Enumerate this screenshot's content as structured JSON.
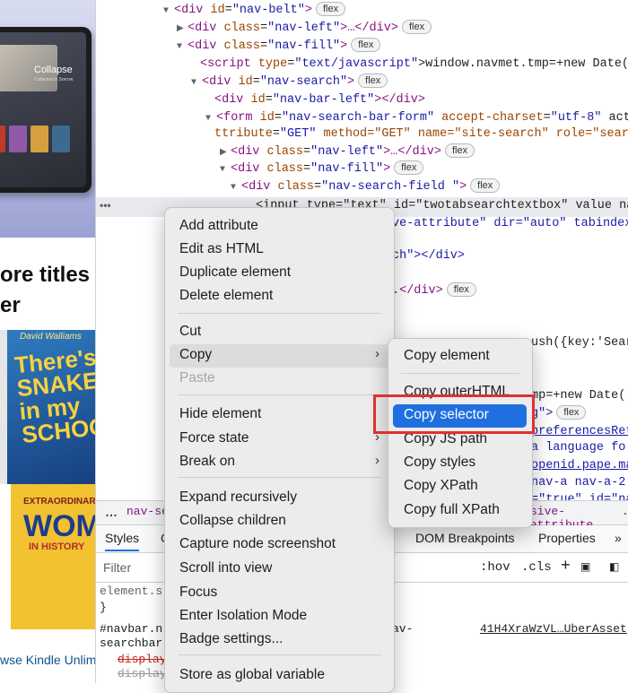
{
  "page": {
    "tablet_title": "Collapse",
    "tablet_subtitle": "Collected in Sorrow",
    "promo_line1": "ore titles",
    "promo_line2": "er",
    "book1_author": "David Walliams",
    "book1_title": "There's a SNAKE in my SCHOOL!",
    "book2_line1": "EXTRAORDINARY",
    "book2_line2": "WOMEN",
    "book2_line3": "IN HISTORY",
    "kindle_link": "wse Kindle Unlim"
  },
  "elements": {
    "lines": [
      {
        "indent": 75,
        "tri": "▼",
        "tag": "div",
        "attrs": [
          [
            "id",
            "nav-belt"
          ]
        ],
        "tail": ">",
        "badge": "flex"
      },
      {
        "indent": 90,
        "tri": "▶",
        "tag": "div",
        "attrs": [
          [
            "class",
            "nav-left"
          ]
        ],
        "tail": ">…</div>",
        "badge": "flex"
      },
      {
        "indent": 90,
        "tri": "▼",
        "tag": "div",
        "attrs": [
          [
            "class",
            "nav-fill"
          ]
        ],
        "tail": ">",
        "badge": "flex"
      },
      {
        "indent": 116,
        "tri": "",
        "tag": "script",
        "attrs": [
          [
            "type",
            "text/javascript"
          ]
        ],
        "tail": ">window.navmet.tmp=+new Date()",
        "badge": ""
      },
      {
        "indent": 106,
        "tri": "▼",
        "tag": "div",
        "attrs": [
          [
            "id",
            "nav-search"
          ]
        ],
        "tail": ">",
        "badge": "flex"
      },
      {
        "indent": 132,
        "tri": "",
        "tag": "div",
        "attrs": [
          [
            "id",
            "nav-bar-left"
          ]
        ],
        "tail": "></div>",
        "badge": ""
      },
      {
        "indent": 122,
        "tri": "▼",
        "tag": "form",
        "attrs": [
          [
            "id",
            "nav-search-bar-form"
          ],
          [
            "accept-charset",
            "utf-8"
          ]
        ],
        "tail": " acti",
        "badge": ""
      },
      {
        "indent": 132,
        "tri": "",
        "tag": "",
        "attrs": [
          [
            "ttribute",
            "GET"
          ]
        ],
        "tail": "",
        "badge": ""
      },
      {
        "indent": 138,
        "tri": "▶",
        "tag": "div",
        "attrs": [
          [
            "class",
            "nav-left"
          ]
        ],
        "tail": ">…</div>",
        "badge": "flex"
      },
      {
        "indent": 138,
        "tri": "▼",
        "tag": "div",
        "attrs": [
          [
            "class",
            "nav-fill"
          ]
        ],
        "tail": ">",
        "badge": "flex"
      },
      {
        "indent": 150,
        "tri": "▼",
        "tag": "div",
        "attrs": [
          [
            "class",
            "nav-search-field "
          ]
        ],
        "tail": ">",
        "badge": "flex"
      }
    ],
    "line9_extra": " method=\"GET\" name=\"site-search\" role=\"search\">",
    "partial": {
      "selected_line": "<input type=\"text\" id=\"twotabsearchtextbox\" value nam",
      "l_ve_attr": "ve-attribute\" dir=\"auto\" tabindex",
      "l_ch": "ch\"></div>",
      "l_div": ".</div>",
      "l_div_badge": "flex",
      "l_ush": "ush({key:'Sear",
      "l_date": "mp=+new Date()",
      "l_g": "g\">",
      "l_g_badge": "flex",
      "l_pref": "preferencesRet",
      "l_lang": "a language fo",
      "l_openid": "openid.pape.ma",
      "l_nava": "nav-a nav-a-2",
      "l_true": "=\"true\" id=\"na"
    }
  },
  "breadcrumb": {
    "dots": "…",
    "first": "nav-se",
    "last": "sive-attribute",
    "last_tail": "."
  },
  "panel": {
    "tabs": [
      "Styles",
      "C",
      "DOM Breakpoints",
      "Properties",
      "»"
    ],
    "filter_placeholder": "Filter",
    "hov": ":hov",
    "cls": ".cls",
    "plus": "+",
    "styles": {
      "line1": "element.s",
      "line2": "}",
      "line3": "#navbar.n",
      "line3b": "av-",
      "line4": "searchbar",
      "line5": "display",
      "line6": "display",
      "asset": "41H4XraWzVL…UberAsset"
    }
  },
  "menu": {
    "items": [
      {
        "label": "Add attribute",
        "enabled": true
      },
      {
        "label": "Edit as HTML",
        "enabled": true
      },
      {
        "label": "Duplicate element",
        "enabled": true
      },
      {
        "label": "Delete element",
        "enabled": true
      },
      {
        "label": "Cut",
        "enabled": true
      },
      {
        "label": "Copy",
        "enabled": true,
        "submenu": true,
        "highlighted": true
      },
      {
        "label": "Paste",
        "enabled": false
      },
      {
        "label": "Hide element",
        "enabled": true
      },
      {
        "label": "Force state",
        "enabled": true,
        "submenu": true
      },
      {
        "label": "Break on",
        "enabled": true,
        "submenu": true
      },
      {
        "label": "Expand recursively",
        "enabled": true
      },
      {
        "label": "Collapse children",
        "enabled": true
      },
      {
        "label": "Capture node screenshot",
        "enabled": true
      },
      {
        "label": "Scroll into view",
        "enabled": true
      },
      {
        "label": "Focus",
        "enabled": true
      },
      {
        "label": "Enter Isolation Mode",
        "enabled": true
      },
      {
        "label": "Badge settings...",
        "enabled": true
      },
      {
        "label": "Store as global variable",
        "enabled": true
      }
    ],
    "chevron": "›"
  },
  "submenu": {
    "items": [
      {
        "label": "Copy element"
      },
      {
        "label": "Copy outerHTML"
      },
      {
        "label": "Copy selector",
        "active": true
      },
      {
        "label": "Copy JS path"
      },
      {
        "label": "Copy styles"
      },
      {
        "label": "Copy XPath"
      },
      {
        "label": "Copy full XPath"
      }
    ],
    "active_color": "#1f6fe0",
    "callout_color": "#e0302f"
  }
}
